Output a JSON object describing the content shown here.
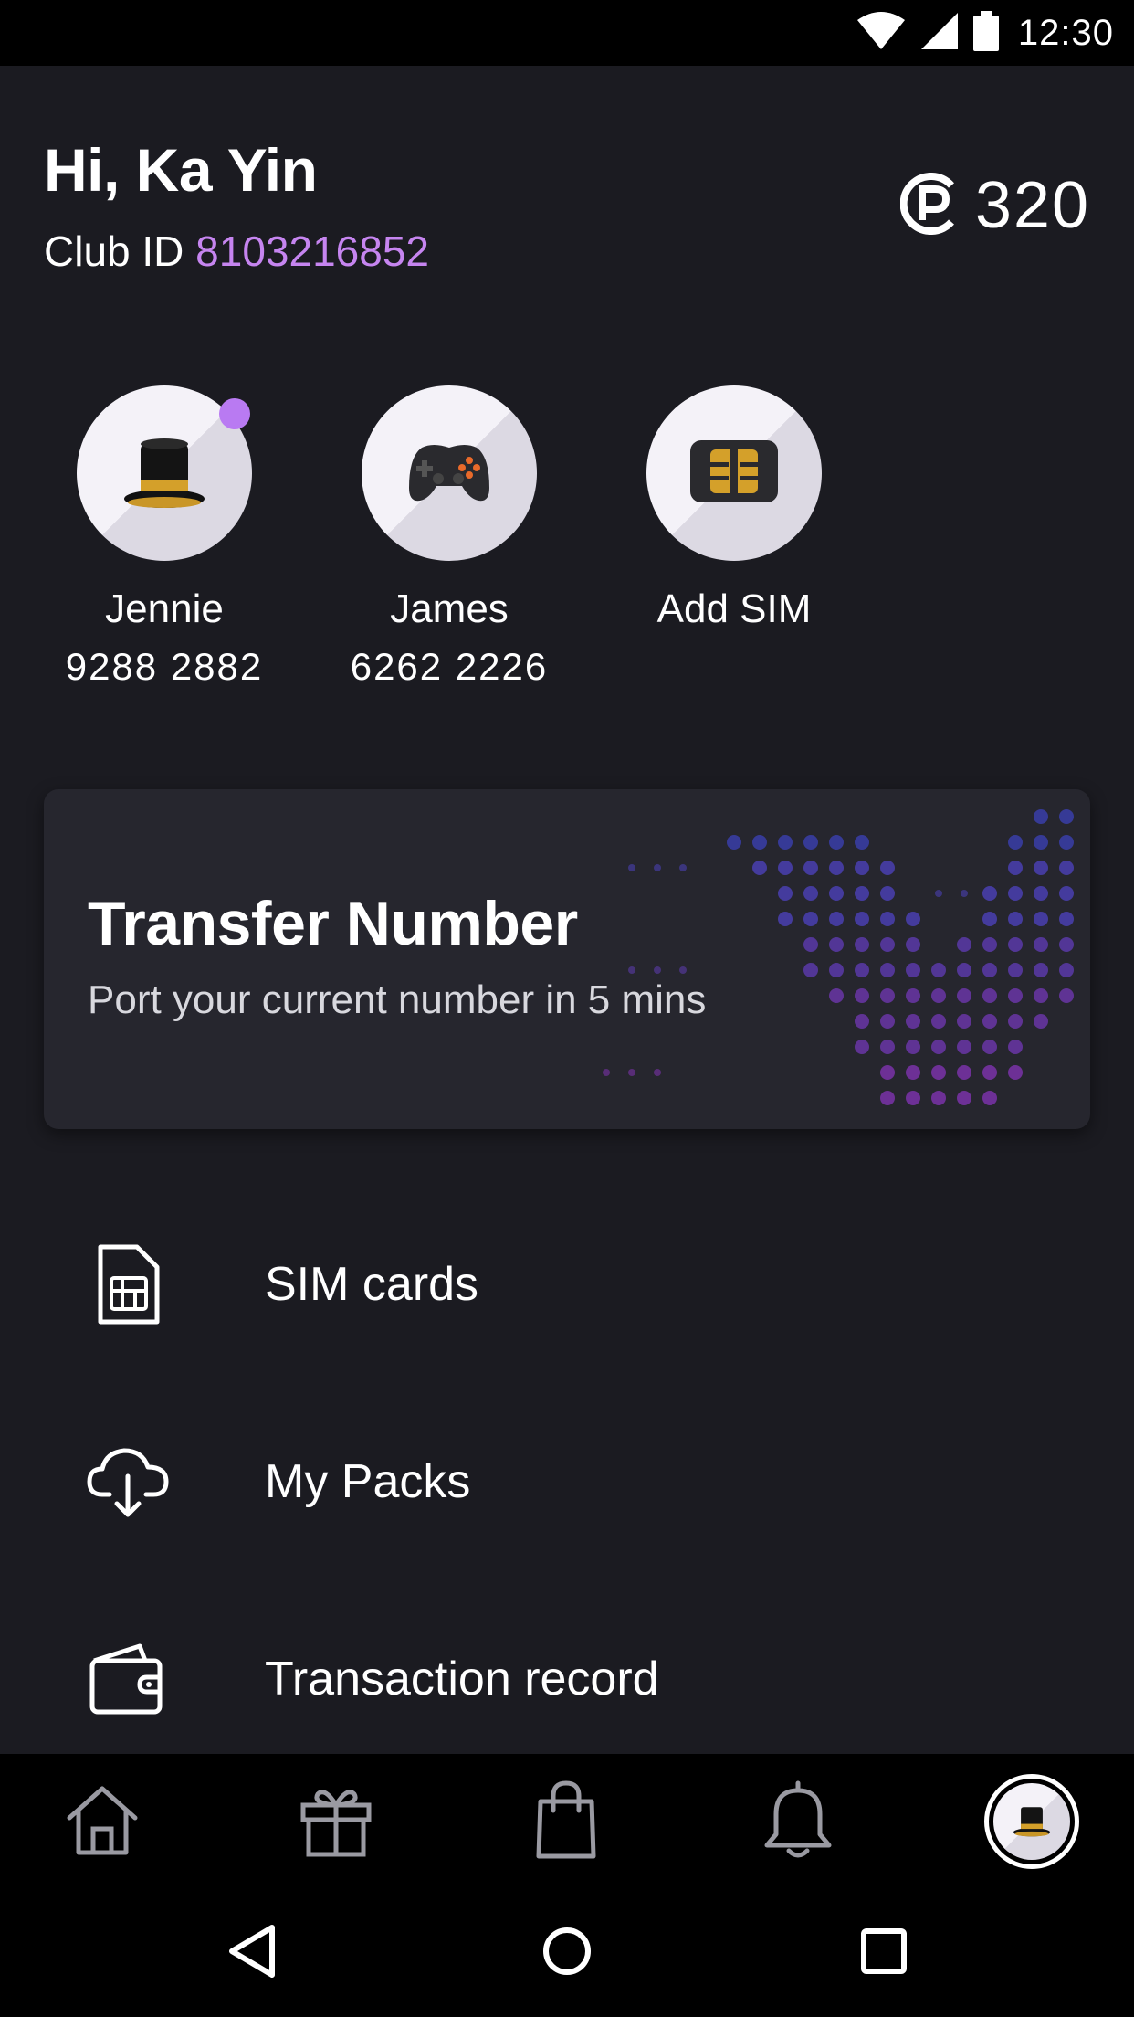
{
  "status_bar": {
    "time": "12:30",
    "icons": [
      "wifi-icon",
      "cellular-signal-icon",
      "battery-icon"
    ]
  },
  "header": {
    "greeting": "Hi, Ka Yin",
    "club_label": "Club ID",
    "club_id": "8103216852",
    "points_icon": "points-coin-icon",
    "points_value": "320"
  },
  "sims": [
    {
      "name": "Jennie",
      "number": "9288 2882",
      "icon": "top-hat-icon",
      "has_notification": true
    },
    {
      "name": "James",
      "number": "6262 2226",
      "icon": "game-controller-icon",
      "has_notification": false
    },
    {
      "name": "Add SIM",
      "number": "",
      "icon": "sim-chip-icon",
      "has_notification": false
    }
  ],
  "transfer_card": {
    "title": "Transfer Number",
    "subtitle": "Port your current number in 5 mins"
  },
  "menu": [
    {
      "label": "SIM cards",
      "icon": "sim-card-icon"
    },
    {
      "label": "My Packs",
      "icon": "cloud-download-icon"
    },
    {
      "label": "Transaction record",
      "icon": "wallet-icon"
    }
  ],
  "bottom_nav": {
    "items": [
      "home-icon",
      "gift-icon",
      "shopping-bag-icon",
      "bell-icon",
      "profile-avatar-icon"
    ],
    "active": "profile-avatar-icon"
  },
  "system_nav": [
    "back-icon",
    "home-circle-icon",
    "recents-icon"
  ],
  "colors": {
    "background": "#1b1b21",
    "accent_purple": "#c685f0",
    "card_background": "#26262e"
  }
}
